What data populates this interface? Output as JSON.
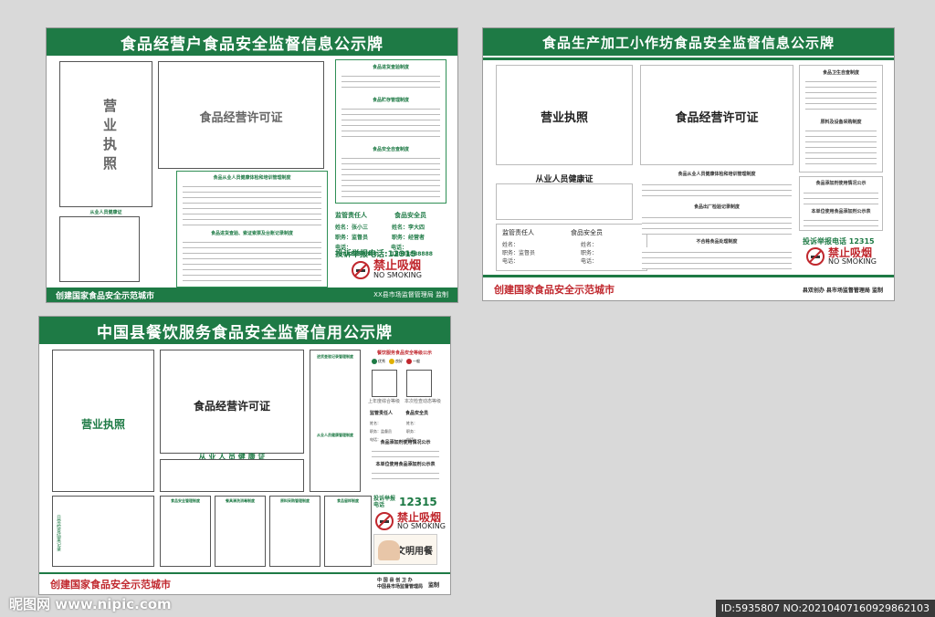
{
  "board1": {
    "title": "食品经营户食品安全监督信息公示牌",
    "license_vertical": "营业执照",
    "license_food": "食品经营许可证",
    "health_cert": "从业人员健康证",
    "rules1_title": "食品进货查验制度",
    "rules2_title": "食品贮存管理制度",
    "rules3_title": "食品安全自查制度",
    "rules4_title": "食品从业人员健康体检和培训管理制度",
    "rules5_title": "食品进货查验、索证索票及台账记录制度",
    "supervisor_h": "监管责任人",
    "safety_h": "食品安全员",
    "name_l": "姓名",
    "sup_name": "张小三",
    "saf_name": "李大四",
    "post_l": "职务",
    "sup_post": "监督员",
    "saf_post": "经营者",
    "tel_l": "电话",
    "sup_tel": "18888888888",
    "saf_tel": "18888888888",
    "complaint": "投诉举报电话:12315",
    "nosmoke_cn": "禁止吸烟",
    "nosmoke_en": "NO SMOKING",
    "footer_left": "创建国家食品安全示范城市",
    "footer_right": "XX县市场监督管理局 监制"
  },
  "board2": {
    "title": "食品生产加工小作坊食品安全监督信息公示牌",
    "license": "营业执照",
    "license_food": "食品经营许可证",
    "health_cert": "从业人员健康证",
    "rule_title": "食品从业人员健康体检和培训管理制度",
    "rule_title2": "食品出厂检验记录制度",
    "rule_title3": "不合格食品处理制度",
    "right_title1": "食品卫生自查制度",
    "right_title2": "原料及设备采购制度",
    "table_title": "食品添加剂使用情况公示",
    "table_title2": "本单位使用食品添加剂公示表",
    "supervisor_h": "监管责任人",
    "safety_h": "食品安全员",
    "name_l": "姓名",
    "post_l": "职务",
    "sup_post": "监督员",
    "tel_l": "电话",
    "complaint": "投诉举报电话 12315",
    "nosmoke_cn": "禁止吸烟",
    "nosmoke_en": "NO SMOKING",
    "footer_left": "创建国家食品安全示范城市",
    "footer_right": "县双创办  县市场监督管理局 监制"
  },
  "board3": {
    "title": "中国县餐饮服务食品安全监督信用公示牌",
    "license": "营业执照",
    "license_food": "食品经营许可证",
    "health_cert": "从 业 人 员 健 康 证",
    "col_title": "进货查验记录管理制度",
    "col_title2": "从业人员健康管理制度",
    "side_text": "日常检查结果记录",
    "grade_title": "餐饮服务食品安全等级公示",
    "grade_a": "优秀",
    "grade_b": "良好",
    "grade_c": "一般",
    "year_l": "上年度综合等级",
    "now_l": "本次检查动态等级",
    "supervisor_h": "监管责任人",
    "safety_h": "食品安全员",
    "name_l": "姓名",
    "post_l": "职务",
    "sup_post": "监督员",
    "tel_l": "电话",
    "additive_title": "食品添加剂使用情况公示",
    "additive_title2": "本单位使用食品添加剂公示表",
    "complaint_l": "投诉举报\n电话",
    "complaint_n": "12315",
    "nosmoke_cn": "禁止吸烟",
    "nosmoke_en": "NO SMOKING",
    "civil": "文明用餐",
    "small1": "食品安全管理制度",
    "small2": "餐具清洗消毒制度",
    "small3": "原料采购管理制度",
    "small4": "食品留样制度",
    "small5": "从业人员健康管理制度",
    "footer_left": "创建国家食品安全示范城市",
    "footer_right1": "中 国 县 创 卫 办",
    "footer_right2": "中国县市场监督管理局",
    "footer_mark": "监制"
  },
  "watermark": {
    "logo": "昵图网 www.nipic.com",
    "id": "ID:5935807 NO:20210407160929862103"
  },
  "colors": {
    "green": "#1e7a45",
    "red": "#c0272d"
  }
}
